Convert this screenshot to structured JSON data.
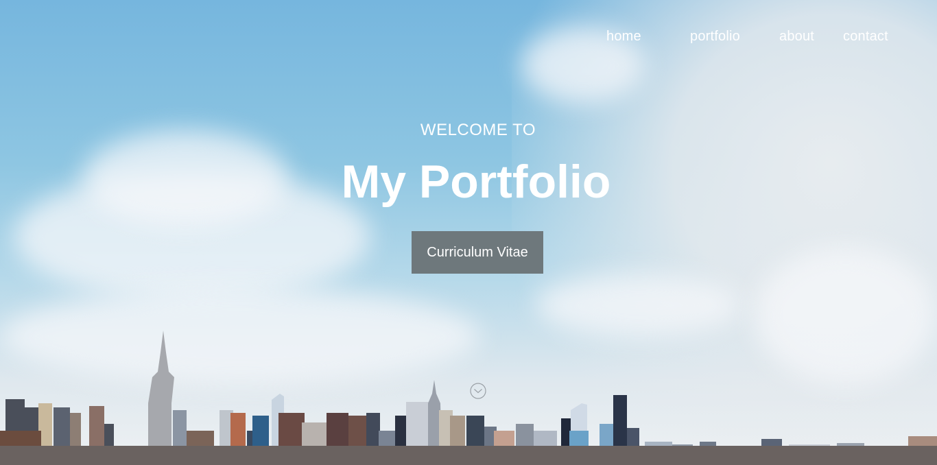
{
  "nav": {
    "items": [
      {
        "label": "home"
      },
      {
        "label": "portfolio"
      },
      {
        "label": "about"
      },
      {
        "label": "contact"
      }
    ]
  },
  "hero": {
    "welcome": "WELCOME TO",
    "title": "My Portfolio",
    "cta_label": "Curriculum Vitae",
    "scroll_icon": "chevron-down-circle-icon"
  },
  "colors": {
    "sky_top": "#76b6de",
    "sky_bottom": "#eef1f3",
    "text": "#ffffff",
    "button_bg": "#6e787c"
  }
}
